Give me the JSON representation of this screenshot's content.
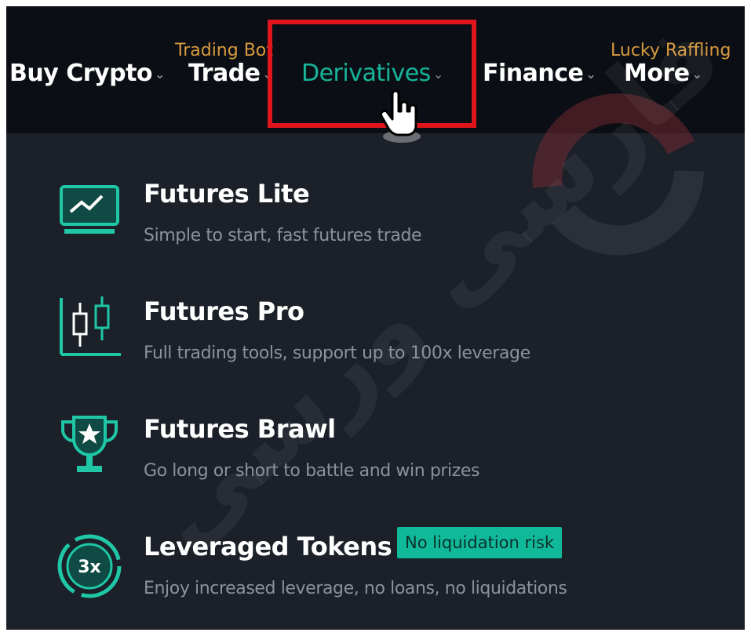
{
  "nav": {
    "items": [
      {
        "label": "Buy Crypto"
      },
      {
        "label": "Trade",
        "tag": "Trading Bot"
      },
      {
        "label": "Derivatives"
      },
      {
        "label": "Finance"
      },
      {
        "label": "More",
        "tag": "Lucky Raffling"
      }
    ],
    "active": "Derivatives",
    "chevron": "⌄"
  },
  "menu": {
    "items": [
      {
        "title": "Futures Lite",
        "desc": "Simple to start, fast futures trade",
        "icon": "monitor-chart-icon"
      },
      {
        "title": "Futures Pro",
        "desc": "Full trading tools, support up to 100x leverage",
        "icon": "candlestick-icon"
      },
      {
        "title": "Futures Brawl",
        "desc": "Go long or short to battle and win prizes",
        "icon": "trophy-icon"
      },
      {
        "title": "Leveraged Tokens",
        "badge": "No liquidation risk",
        "desc": "Enjoy increased leverage, no loans, no liquidations",
        "icon": "3x-token-icon",
        "icon_text": "3x"
      }
    ]
  },
  "colors": {
    "accent": "#16b59a",
    "highlight": "#e0141b",
    "tag": "#d79a3e",
    "navbar_bg": "#0b0e14",
    "panel_bg": "#1b2029"
  }
}
